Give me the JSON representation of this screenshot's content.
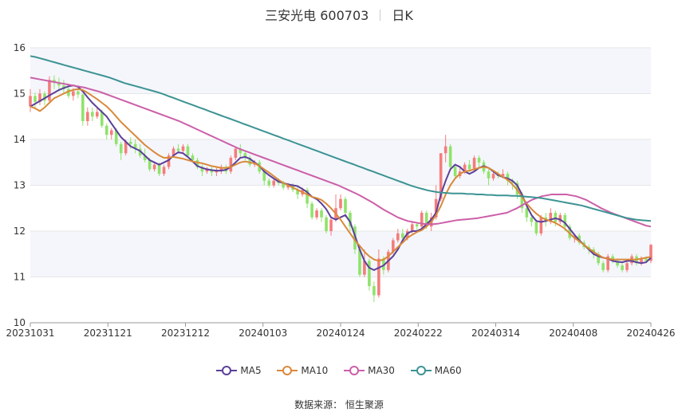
{
  "header": {
    "title": "三安光电 600703",
    "period": "日K"
  },
  "source": "数据来源：  恒生聚源",
  "colors": {
    "up": "#f47c7c",
    "down": "#8fe36b",
    "MA5": "#5b3f99",
    "MA10": "#d9893a",
    "MA30": "#cc5fa8",
    "MA60": "#3d9393",
    "band": "#f4f6fb",
    "grid": "#e6e6e6"
  },
  "chart_data": {
    "type": "candlestick",
    "title": "三安光电 600703",
    "subtitle": "日K",
    "ylim": [
      10,
      16
    ],
    "yticks": [
      10,
      11,
      12,
      13,
      14,
      15,
      16
    ],
    "xlim": [
      "20231031",
      "20240426"
    ],
    "xticks": [
      "20231031",
      "20231121",
      "20231212",
      "20240103",
      "20240124",
      "20240222",
      "20240314",
      "20240408",
      "20240426"
    ],
    "legend": [
      "MA5",
      "MA10",
      "MA30",
      "MA60"
    ],
    "legend_position": "bottom",
    "candles": [
      [
        14.72,
        14.95,
        14.6,
        15.1
      ],
      [
        14.95,
        14.82,
        14.7,
        15.02
      ],
      [
        14.82,
        15.0,
        14.75,
        15.1
      ],
      [
        15.0,
        14.85,
        14.75,
        15.05
      ],
      [
        14.85,
        15.3,
        14.8,
        15.38
      ],
      [
        15.3,
        15.25,
        15.1,
        15.4
      ],
      [
        15.25,
        15.18,
        15.05,
        15.35
      ],
      [
        15.18,
        15.1,
        15.0,
        15.3
      ],
      [
        15.1,
        14.95,
        14.9,
        15.2
      ],
      [
        14.95,
        15.05,
        14.85,
        15.12
      ],
      [
        15.05,
        14.98,
        14.9,
        15.15
      ],
      [
        14.98,
        14.4,
        14.3,
        15.0
      ],
      [
        14.4,
        14.6,
        14.3,
        14.7
      ],
      [
        14.6,
        14.5,
        14.4,
        14.7
      ],
      [
        14.5,
        14.6,
        14.45,
        14.7
      ],
      [
        14.6,
        14.3,
        14.25,
        14.65
      ],
      [
        14.3,
        14.1,
        14.0,
        14.35
      ],
      [
        14.1,
        14.2,
        14.0,
        14.25
      ],
      [
        14.2,
        13.9,
        13.85,
        14.25
      ],
      [
        13.9,
        13.7,
        13.55,
        13.95
      ],
      [
        13.7,
        13.95,
        13.65,
        14.0
      ],
      [
        13.95,
        13.9,
        13.8,
        14.05
      ],
      [
        13.9,
        13.8,
        13.7,
        14.0
      ],
      [
        13.8,
        13.65,
        13.6,
        13.9
      ],
      [
        13.65,
        13.55,
        13.5,
        13.8
      ],
      [
        13.55,
        13.35,
        13.3,
        13.6
      ],
      [
        13.35,
        13.45,
        13.3,
        13.5
      ],
      [
        13.45,
        13.25,
        13.2,
        13.5
      ],
      [
        13.25,
        13.4,
        13.2,
        13.45
      ],
      [
        13.4,
        13.65,
        13.35,
        13.7
      ],
      [
        13.65,
        13.8,
        13.6,
        13.85
      ],
      [
        13.8,
        13.75,
        13.7,
        13.9
      ],
      [
        13.75,
        13.85,
        13.7,
        13.9
      ],
      [
        13.85,
        13.65,
        13.6,
        13.9
      ],
      [
        13.65,
        13.55,
        13.5,
        13.7
      ],
      [
        13.55,
        13.4,
        13.35,
        13.6
      ],
      [
        13.4,
        13.3,
        13.2,
        13.45
      ],
      [
        13.3,
        13.35,
        13.25,
        13.4
      ],
      [
        13.35,
        13.28,
        13.2,
        13.4
      ],
      [
        13.28,
        13.32,
        13.2,
        13.38
      ],
      [
        13.32,
        13.4,
        13.25,
        13.45
      ],
      [
        13.4,
        13.3,
        13.25,
        13.45
      ],
      [
        13.3,
        13.6,
        13.25,
        13.65
      ],
      [
        13.6,
        13.8,
        13.55,
        13.85
      ],
      [
        13.8,
        13.7,
        13.6,
        13.9
      ],
      [
        13.7,
        13.6,
        13.55,
        13.75
      ],
      [
        13.6,
        13.45,
        13.4,
        13.65
      ],
      [
        13.45,
        13.5,
        13.4,
        13.55
      ],
      [
        13.5,
        13.3,
        13.25,
        13.55
      ],
      [
        13.3,
        13.1,
        13.0,
        13.35
      ],
      [
        13.1,
        13.0,
        12.95,
        13.15
      ],
      [
        13.0,
        13.1,
        12.95,
        13.15
      ],
      [
        13.1,
        13.05,
        13.0,
        13.15
      ],
      [
        13.05,
        12.95,
        12.9,
        13.1
      ],
      [
        12.95,
        13.0,
        12.9,
        13.05
      ],
      [
        13.0,
        12.9,
        12.85,
        13.05
      ],
      [
        12.9,
        12.8,
        12.7,
        12.95
      ],
      [
        12.8,
        12.9,
        12.75,
        12.95
      ],
      [
        12.9,
        12.6,
        12.5,
        12.95
      ],
      [
        12.6,
        12.3,
        12.25,
        12.65
      ],
      [
        12.3,
        12.45,
        12.25,
        12.5
      ],
      [
        12.45,
        12.3,
        12.2,
        12.5
      ],
      [
        12.3,
        12.0,
        11.95,
        12.35
      ],
      [
        12.0,
        12.25,
        11.9,
        12.3
      ],
      [
        12.25,
        12.5,
        12.2,
        12.8
      ],
      [
        12.5,
        12.7,
        12.45,
        12.8
      ],
      [
        12.7,
        12.4,
        12.3,
        12.75
      ],
      [
        12.4,
        12.1,
        12.0,
        12.45
      ],
      [
        12.1,
        11.6,
        11.5,
        12.15
      ],
      [
        11.6,
        11.05,
        11.0,
        11.65
      ],
      [
        11.05,
        11.35,
        11.0,
        11.6
      ],
      [
        11.35,
        10.8,
        10.7,
        11.4
      ],
      [
        10.8,
        10.6,
        10.45,
        10.9
      ],
      [
        10.6,
        11.4,
        10.55,
        11.6
      ],
      [
        11.4,
        11.15,
        11.05,
        11.45
      ],
      [
        11.15,
        11.55,
        11.1,
        11.6
      ],
      [
        11.55,
        11.8,
        11.5,
        11.85
      ],
      [
        11.8,
        11.95,
        11.75,
        12.05
      ],
      [
        11.95,
        11.85,
        11.8,
        12.05
      ],
      [
        11.85,
        12.0,
        11.8,
        12.05
      ],
      [
        12.0,
        12.15,
        11.95,
        12.2
      ],
      [
        12.15,
        12.1,
        12.0,
        12.2
      ],
      [
        12.1,
        12.4,
        12.05,
        12.45
      ],
      [
        12.4,
        12.1,
        12.05,
        12.45
      ],
      [
        12.1,
        12.3,
        12.0,
        12.4
      ],
      [
        12.3,
        12.7,
        12.25,
        13.0
      ],
      [
        12.7,
        13.7,
        12.65,
        13.7
      ],
      [
        13.7,
        13.85,
        13.5,
        14.1
      ],
      [
        13.85,
        13.4,
        13.35,
        13.9
      ],
      [
        13.4,
        13.2,
        13.15,
        13.45
      ],
      [
        13.2,
        13.3,
        13.15,
        13.4
      ],
      [
        13.3,
        13.45,
        13.25,
        13.5
      ],
      [
        13.45,
        13.35,
        13.3,
        13.55
      ],
      [
        13.35,
        13.6,
        13.3,
        13.65
      ],
      [
        13.6,
        13.5,
        13.4,
        13.65
      ],
      [
        13.5,
        13.3,
        13.25,
        13.55
      ],
      [
        13.3,
        13.15,
        13.0,
        13.35
      ],
      [
        13.15,
        13.25,
        13.1,
        13.3
      ],
      [
        13.25,
        13.2,
        13.15,
        13.3
      ],
      [
        13.2,
        13.25,
        13.15,
        13.35
      ],
      [
        13.25,
        13.1,
        13.0,
        13.3
      ],
      [
        13.1,
        13.05,
        12.9,
        13.15
      ],
      [
        13.05,
        12.8,
        12.7,
        13.1
      ],
      [
        12.8,
        12.5,
        12.4,
        12.85
      ],
      [
        12.5,
        12.3,
        12.2,
        12.55
      ],
      [
        12.3,
        12.2,
        12.1,
        12.35
      ],
      [
        12.2,
        11.95,
        11.9,
        12.25
      ],
      [
        11.95,
        12.3,
        11.9,
        12.35
      ],
      [
        12.3,
        12.2,
        12.1,
        12.4
      ],
      [
        12.2,
        12.4,
        12.15,
        12.5
      ],
      [
        12.4,
        12.2,
        12.1,
        12.45
      ],
      [
        12.2,
        12.35,
        12.15,
        12.4
      ],
      [
        12.35,
        12.1,
        12.0,
        12.4
      ],
      [
        12.1,
        11.85,
        11.8,
        12.15
      ],
      [
        11.85,
        11.9,
        11.75,
        11.95
      ],
      [
        11.9,
        11.75,
        11.7,
        11.95
      ],
      [
        11.75,
        11.65,
        11.6,
        11.8
      ],
      [
        11.65,
        11.6,
        11.5,
        11.7
      ],
      [
        11.6,
        11.5,
        11.4,
        11.65
      ],
      [
        11.5,
        11.3,
        11.25,
        11.55
      ],
      [
        11.3,
        11.15,
        11.1,
        11.35
      ],
      [
        11.15,
        11.45,
        11.1,
        11.5
      ],
      [
        11.45,
        11.35,
        11.3,
        11.5
      ],
      [
        11.35,
        11.25,
        11.2,
        11.4
      ],
      [
        11.25,
        11.15,
        11.1,
        11.3
      ],
      [
        11.15,
        11.3,
        11.1,
        11.35
      ],
      [
        11.3,
        11.45,
        11.25,
        11.5
      ],
      [
        11.45,
        11.3,
        11.25,
        11.5
      ],
      [
        11.3,
        11.4,
        11.25,
        11.45
      ],
      [
        11.4,
        11.35,
        11.3,
        11.45
      ],
      [
        11.35,
        11.7,
        11.3,
        11.72
      ]
    ],
    "series": [
      {
        "name": "MA5",
        "values": [
          14.72,
          14.78,
          14.84,
          14.9,
          14.96,
          15.02,
          15.08,
          15.12,
          15.16,
          15.18,
          15.15,
          15.05,
          14.92,
          14.8,
          14.7,
          14.6,
          14.5,
          14.35,
          14.2,
          14.05,
          13.95,
          13.85,
          13.8,
          13.75,
          13.65,
          13.55,
          13.5,
          13.45,
          13.5,
          13.55,
          13.65,
          13.72,
          13.7,
          13.62,
          13.52,
          13.42,
          13.38,
          13.35,
          13.33,
          13.32,
          13.32,
          13.34,
          13.4,
          13.5,
          13.6,
          13.62,
          13.58,
          13.5,
          13.42,
          13.3,
          13.22,
          13.15,
          13.08,
          13.05,
          13.02,
          13.0,
          12.98,
          12.92,
          12.85,
          12.75,
          12.7,
          12.6,
          12.48,
          12.3,
          12.25,
          12.3,
          12.35,
          12.2,
          11.9,
          11.6,
          11.35,
          11.2,
          11.15,
          11.2,
          11.25,
          11.35,
          11.45,
          11.6,
          11.8,
          11.95,
          12.0,
          12.0,
          12.05,
          12.15,
          12.25,
          12.4,
          12.8,
          13.1,
          13.35,
          13.45,
          13.4,
          13.3,
          13.25,
          13.3,
          13.38,
          13.42,
          13.38,
          13.3,
          13.22,
          13.18,
          13.15,
          13.1,
          13.0,
          12.8,
          12.55,
          12.35,
          12.22,
          12.2,
          12.22,
          12.25,
          12.28,
          12.25,
          12.18,
          12.05,
          11.92,
          11.8,
          11.7,
          11.6,
          11.5,
          11.45,
          11.42,
          11.4,
          11.35,
          11.33,
          11.32,
          11.35,
          11.35,
          11.32,
          11.3,
          11.32,
          11.42
        ]
      },
      {
        "name": "MA10",
        "values": [
          14.72,
          14.68,
          14.62,
          14.7,
          14.8,
          14.9,
          14.95,
          15.0,
          15.05,
          15.08,
          15.1,
          15.08,
          15.02,
          14.95,
          14.88,
          14.8,
          14.72,
          14.62,
          14.5,
          14.38,
          14.28,
          14.18,
          14.08,
          13.98,
          13.88,
          13.8,
          13.72,
          13.65,
          13.6,
          13.6,
          13.62,
          13.6,
          13.58,
          13.55,
          13.52,
          13.5,
          13.48,
          13.45,
          13.42,
          13.4,
          13.38,
          13.38,
          13.4,
          13.45,
          13.5,
          13.52,
          13.5,
          13.48,
          13.42,
          13.35,
          13.28,
          13.2,
          13.12,
          13.05,
          13.0,
          12.95,
          12.9,
          12.85,
          12.8,
          12.75,
          12.72,
          12.68,
          12.6,
          12.5,
          12.38,
          12.25,
          12.1,
          11.95,
          11.8,
          11.68,
          11.55,
          11.45,
          11.38,
          11.35,
          11.38,
          11.45,
          11.55,
          11.65,
          11.75,
          11.85,
          11.92,
          11.98,
          12.02,
          12.1,
          12.2,
          12.35,
          12.55,
          12.8,
          13.0,
          13.15,
          13.25,
          13.3,
          13.32,
          13.35,
          13.38,
          13.4,
          13.38,
          13.32,
          13.25,
          13.18,
          13.12,
          13.02,
          12.9,
          12.75,
          12.6,
          12.48,
          12.38,
          12.3,
          12.25,
          12.22,
          12.18,
          12.12,
          12.05,
          11.95,
          11.85,
          11.78,
          11.7,
          11.62,
          11.55,
          11.48,
          11.42,
          11.4,
          11.38,
          11.38,
          11.38,
          11.38,
          11.38,
          11.38,
          11.4,
          11.42,
          11.44
        ]
      },
      {
        "name": "MA30",
        "values": [
          15.35,
          15.33,
          15.31,
          15.29,
          15.27,
          15.25,
          15.23,
          15.21,
          15.19,
          15.17,
          15.15,
          15.13,
          15.1,
          15.07,
          15.04,
          15.0,
          14.96,
          14.92,
          14.88,
          14.84,
          14.8,
          14.76,
          14.72,
          14.68,
          14.64,
          14.6,
          14.56,
          14.52,
          14.48,
          14.44,
          14.4,
          14.35,
          14.3,
          14.25,
          14.2,
          14.15,
          14.1,
          14.05,
          14.0,
          13.95,
          13.9,
          13.85,
          13.8,
          13.76,
          13.72,
          13.68,
          13.64,
          13.6,
          13.56,
          13.52,
          13.48,
          13.44,
          13.4,
          13.36,
          13.32,
          13.28,
          13.24,
          13.2,
          13.16,
          13.12,
          13.08,
          13.04,
          13.0,
          12.95,
          12.9,
          12.85,
          12.8,
          12.74,
          12.68,
          12.62,
          12.55,
          12.48,
          12.42,
          12.36,
          12.3,
          12.26,
          12.22,
          12.2,
          12.18,
          12.16,
          12.15,
          12.15,
          12.16,
          12.18,
          12.2,
          12.22,
          12.24,
          12.25,
          12.26,
          12.27,
          12.28,
          12.3,
          12.32,
          12.34,
          12.36,
          12.38,
          12.4,
          12.45,
          12.5,
          12.56,
          12.62,
          12.68,
          12.72,
          12.76,
          12.78,
          12.8,
          12.8,
          12.8,
          12.8,
          12.78,
          12.76,
          12.72,
          12.68,
          12.62,
          12.56,
          12.5,
          12.45,
          12.4,
          12.36,
          12.32,
          12.28,
          12.24,
          12.2,
          12.16,
          12.12,
          12.1
        ]
      },
      {
        "name": "MA60",
        "values": [
          15.82,
          15.8,
          15.77,
          15.74,
          15.71,
          15.68,
          15.65,
          15.62,
          15.59,
          15.56,
          15.53,
          15.5,
          15.47,
          15.44,
          15.41,
          15.38,
          15.35,
          15.31,
          15.27,
          15.23,
          15.2,
          15.17,
          15.14,
          15.11,
          15.08,
          15.05,
          15.02,
          14.98,
          14.94,
          14.9,
          14.86,
          14.82,
          14.78,
          14.74,
          14.7,
          14.66,
          14.62,
          14.58,
          14.54,
          14.5,
          14.46,
          14.42,
          14.38,
          14.34,
          14.3,
          14.26,
          14.22,
          14.18,
          14.14,
          14.1,
          14.06,
          14.02,
          13.98,
          13.94,
          13.9,
          13.86,
          13.82,
          13.78,
          13.74,
          13.7,
          13.66,
          13.62,
          13.58,
          13.54,
          13.5,
          13.46,
          13.42,
          13.38,
          13.34,
          13.3,
          13.26,
          13.22,
          13.18,
          13.14,
          13.1,
          13.06,
          13.02,
          12.98,
          12.95,
          12.92,
          12.89,
          12.87,
          12.85,
          12.84,
          12.83,
          12.82,
          12.82,
          12.82,
          12.81,
          12.81,
          12.8,
          12.8,
          12.79,
          12.79,
          12.78,
          12.78,
          12.78,
          12.77,
          12.77,
          12.76,
          12.75,
          12.74,
          12.73,
          12.72,
          12.7,
          12.68,
          12.66,
          12.64,
          12.62,
          12.6,
          12.58,
          12.56,
          12.53,
          12.5,
          12.47,
          12.44,
          12.41,
          12.38,
          12.35,
          12.32,
          12.29,
          12.27,
          12.25,
          12.24,
          12.23,
          12.22
        ]
      }
    ]
  }
}
